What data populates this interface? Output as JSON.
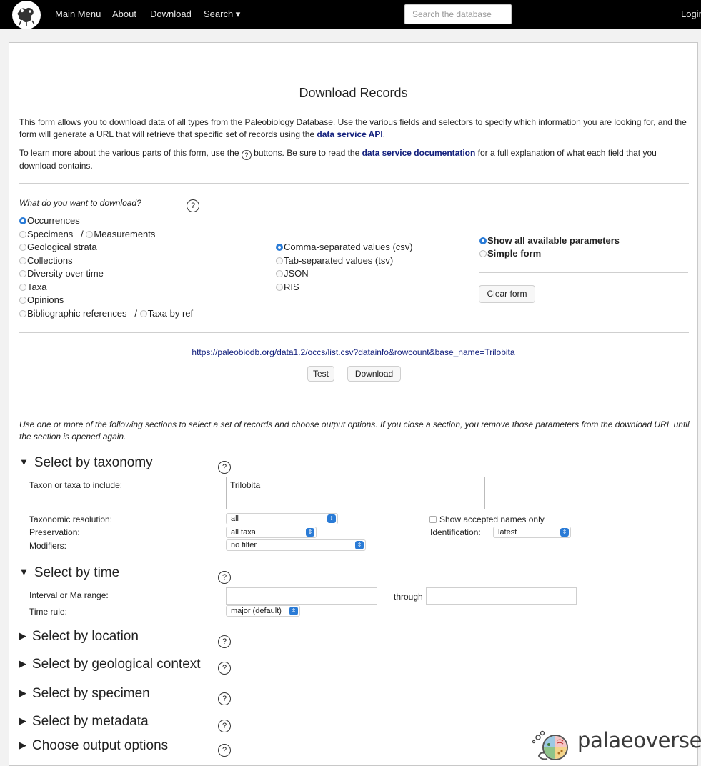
{
  "nav": {
    "items": [
      "Main Menu",
      "About",
      "Download",
      "Search ▾"
    ],
    "search_placeholder": "Search the database",
    "login": "Login"
  },
  "page": {
    "title": "Download Records",
    "intro_1": "This form allows you to download data of all types from the Paleobiology Database. Use the various fields and selectors to specify which information you are looking for, and the form will generate a URL that will retrieve that specific set of records using the ",
    "intro_1_link": "data service API",
    "intro_1_end": ".",
    "intro_2a": "To learn more about the various parts of this form, use the ",
    "intro_2b": " buttons. Be sure to read the ",
    "intro_2_link": "data service documentation",
    "intro_2c": " for a full explanation of what each field that you download contains.",
    "help_glyph": "?"
  },
  "download_type": {
    "question": "What do you want to download?",
    "options": [
      "Occurrences",
      "Specimens",
      "Measurements",
      "Geological strata",
      "Collections",
      "Diversity over time",
      "Taxa",
      "Opinions",
      "Bibliographic references",
      "Taxa by ref"
    ],
    "separator": "/",
    "selected": "Occurrences"
  },
  "formats": {
    "options": [
      "Comma-separated values (csv)",
      "Tab-separated values (tsv)",
      "JSON",
      "RIS"
    ],
    "selected": "Comma-separated values (csv)"
  },
  "form_mode": {
    "options": [
      "Show all available parameters",
      "Simple form"
    ],
    "selected": "Show all available parameters",
    "clear_label": "Clear form"
  },
  "url": {
    "value": "https://paleobiodb.org/data1.2/occs/list.csv?datainfo&rowcount&base_name=Trilobita",
    "test_label": "Test",
    "download_label": "Download"
  },
  "sections_note": "Use one or more of the following sections to select a set of records and choose output options. If you close a section, you remove those parameters from the download URL until the section is opened again.",
  "taxonomy": {
    "heading": "Select by taxonomy",
    "taxa_label": "Taxon or taxa to include:",
    "taxa_value": "Trilobita",
    "resolution_label": "Taxonomic resolution:",
    "resolution_value": "all",
    "preservation_label": "Preservation:",
    "preservation_value": "all taxa",
    "modifiers_label": "Modifiers:",
    "modifiers_value": "no filter",
    "accepted_label": "Show accepted names only",
    "identification_label": "Identification:",
    "identification_value": "latest"
  },
  "time": {
    "heading": "Select by time",
    "interval_label": "Interval or Ma range:",
    "through_label": "through",
    "rule_label": "Time rule:",
    "rule_value": "major (default)"
  },
  "collapsed_sections": [
    "Select by location",
    "Select by geological context",
    "Select by specimen",
    "Select by metadata",
    "Choose output options"
  ],
  "glyphs": {
    "expanded": "▼",
    "collapsed": "▶",
    "select_arrows": "⇕"
  },
  "watermark": {
    "text": "palaeoverse"
  },
  "colors": {
    "link": "#13207d",
    "radio_on": "#2a7bd6",
    "navbar": "#000000"
  },
  "icons": [
    "pbdb-logo-icon",
    "help-icon",
    "select-chevron-icon",
    "palaeoverse-logo-icon"
  ]
}
